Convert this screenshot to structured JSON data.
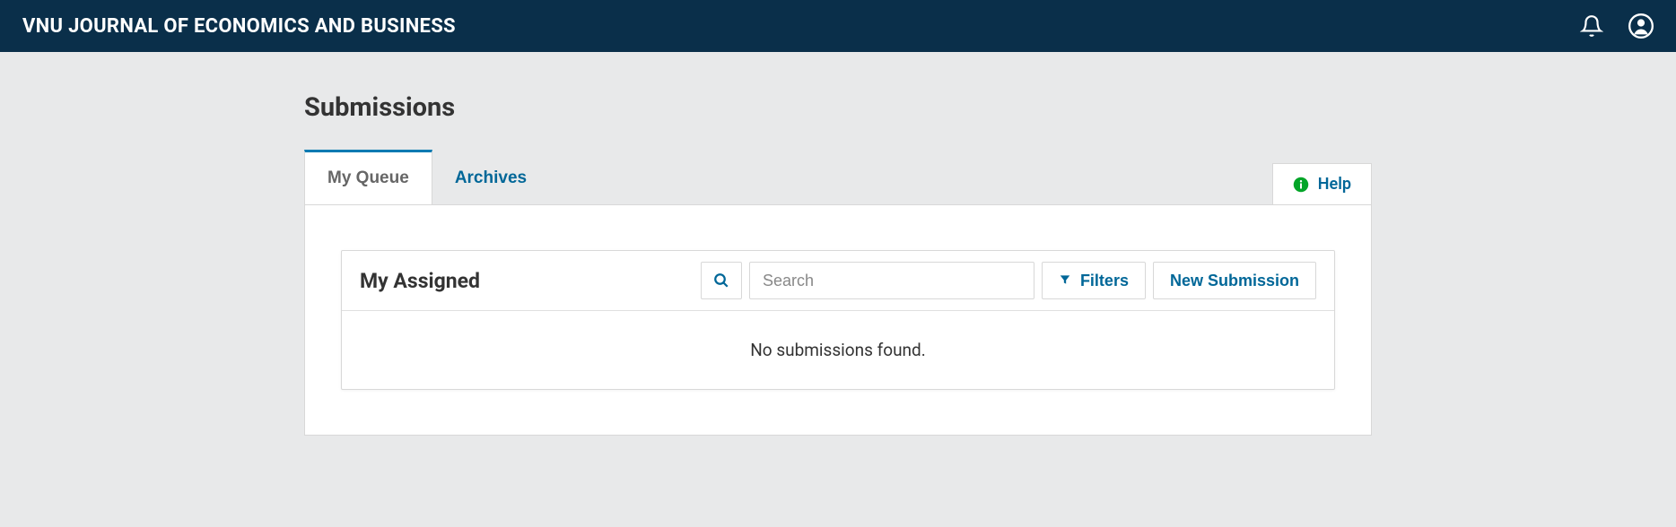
{
  "header": {
    "title": "VNU JOURNAL OF ECONOMICS AND BUSINESS"
  },
  "page": {
    "title": "Submissions"
  },
  "tabs": {
    "my_queue": "My Queue",
    "archives": "Archives",
    "help": "Help"
  },
  "panel": {
    "title": "My Assigned",
    "search_placeholder": "Search",
    "filters_label": "Filters",
    "new_submission_label": "New Submission",
    "empty_message": "No submissions found."
  }
}
